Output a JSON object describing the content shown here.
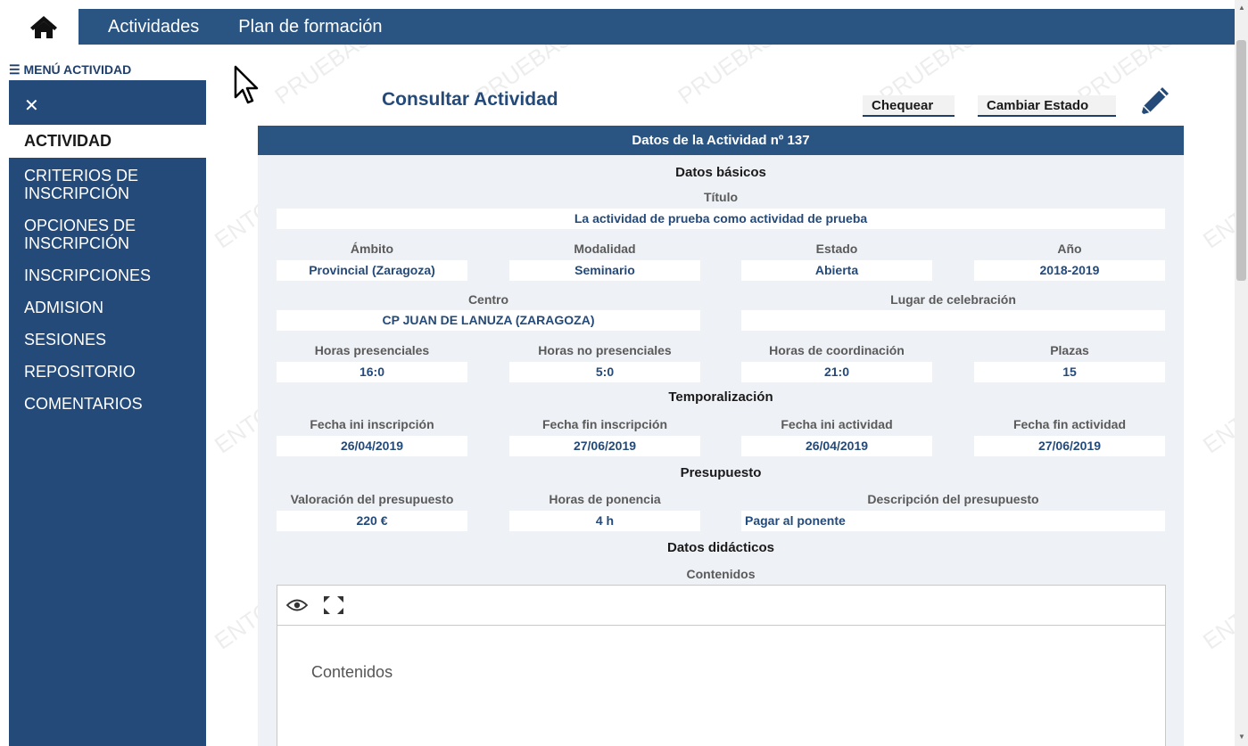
{
  "topbar": {
    "nav": [
      "Actividades",
      "Plan de formación"
    ]
  },
  "sidebar": {
    "header": "☰ MENÚ ACTIVIDAD",
    "close": "✕",
    "items": [
      {
        "label": "ACTIVIDAD"
      },
      {
        "label": "CRITERIOS DE INSCRIPCIÓN"
      },
      {
        "label": "OPCIONES DE INSCRIPCIÓN"
      },
      {
        "label": "INSCRIPCIONES"
      },
      {
        "label": "ADMISION"
      },
      {
        "label": "SESIONES"
      },
      {
        "label": "REPOSITORIO"
      },
      {
        "label": "COMENTARIOS"
      }
    ]
  },
  "page": {
    "title": "Consultar Actividad",
    "check_label": "Chequear",
    "change_state_label": "Cambiar Estado"
  },
  "panel": {
    "header": "Datos de la Actividad nº 137",
    "basic": {
      "section": "Datos básicos",
      "title_label": "Título",
      "title_value": "La actividad de prueba como actividad de prueba",
      "ambito_label": "Ámbito",
      "ambito_value": "Provincial (Zaragoza)",
      "modalidad_label": "Modalidad",
      "modalidad_value": "Seminario",
      "estado_label": "Estado",
      "estado_value": "Abierta",
      "anio_label": "Año",
      "anio_value": "2018-2019",
      "centro_label": "Centro",
      "centro_value": "CP JUAN DE LANUZA (ZARAGOZA)",
      "lugar_label": "Lugar de celebración",
      "lugar_value": "",
      "hp_label": "Horas presenciales",
      "hp_value": "16:0",
      "hnp_label": "Horas no presenciales",
      "hnp_value": "5:0",
      "hc_label": "Horas de coordinación",
      "hc_value": "21:0",
      "plazas_label": "Plazas",
      "plazas_value": "15"
    },
    "temporal": {
      "section": "Temporalización",
      "fii_label": "Fecha ini inscripción",
      "fii_value": "26/04/2019",
      "ffi_label": "Fecha fin inscripción",
      "ffi_value": "27/06/2019",
      "fia_label": "Fecha ini actividad",
      "fia_value": "26/04/2019",
      "ffa_label": "Fecha fin actividad",
      "ffa_value": "27/06/2019"
    },
    "budget": {
      "section": "Presupuesto",
      "val_label": "Valoración del presupuesto",
      "val_value": "220 €",
      "hpon_label": "Horas de ponencia",
      "hpon_value": "4 h",
      "desc_label": "Descripción del presupuesto",
      "desc_value": "Pagar al ponente"
    },
    "didactic": {
      "section": "Datos didácticos",
      "contenidos_label": "Contenidos",
      "editor_placeholder": "Contenidos"
    }
  },
  "watermark": "PRUEBAS",
  "watermark_alt": "ENTORNO",
  "colors": {
    "nav_blue": "#2a5482",
    "sidebar_blue": "#244a7a",
    "panel_bg": "#eef1f5",
    "value_text": "#244a7a"
  }
}
